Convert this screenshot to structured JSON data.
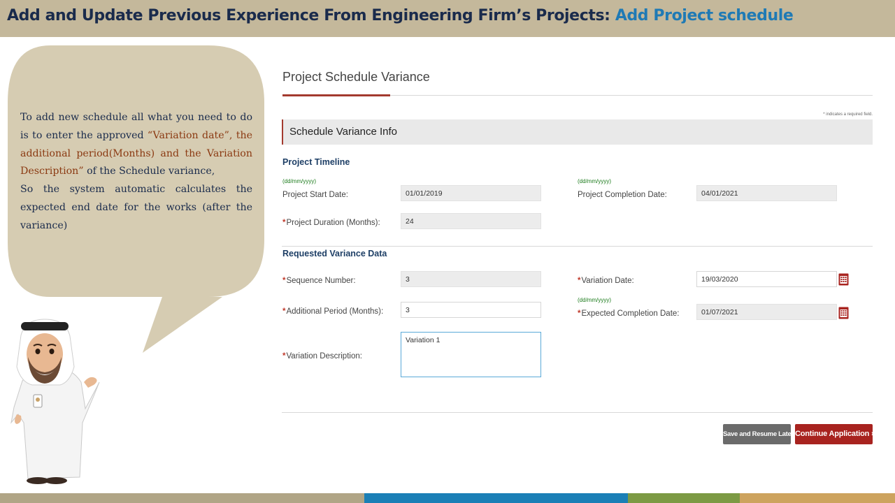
{
  "header": {
    "title_main": "Add and Update Previous Experience From Engineering Firm’s Projects: ",
    "title_accent": "Add Project schedule"
  },
  "bubble": {
    "p1": "To add new schedule all what you need to do is to enter the approved ",
    "p2": "“Variation date”, the additional period(Months) and the Variation Description”",
    "p3": " of the Schedule variance,",
    "p4": "So the system automatic calculates the expected end date for the works (after the variance)"
  },
  "form": {
    "title": "Project Schedule Variance",
    "required_note": "* indicates a required field.",
    "section_title": "Schedule Variance Info",
    "timeline_heading": "Project Timeline",
    "date_format": "(dd/mm/yyyy)",
    "start_date_label": "Project Start Date:",
    "start_date_value": "01/01/2019",
    "completion_date_label": "Project Completion Date:",
    "completion_date_value": "04/01/2021",
    "duration_label": "Project Duration (Months):",
    "duration_value": "24",
    "variance_heading": "Requested Variance Data",
    "sequence_label": "Sequence Number:",
    "sequence_value": "3",
    "variation_date_label": "Variation Date:",
    "variation_date_value": "19/03/2020",
    "additional_period_label": "Additional Period (Months):",
    "additional_period_value": "3",
    "expected_completion_label": "Expected Completion Date:",
    "expected_completion_value": "01/07/2021",
    "description_label": "Variation Description:",
    "description_value": "Variation 1",
    "required_mark": "*"
  },
  "buttons": {
    "save_later": "Save and Resume Later",
    "continue": "Continue Application »"
  },
  "colors": {
    "header_bg": "#c4b89b",
    "title_dark": "#1a2b4c",
    "title_accent": "#1f7ab5",
    "accent_red": "#a33a2f",
    "bubble": "#d6ccb2"
  }
}
